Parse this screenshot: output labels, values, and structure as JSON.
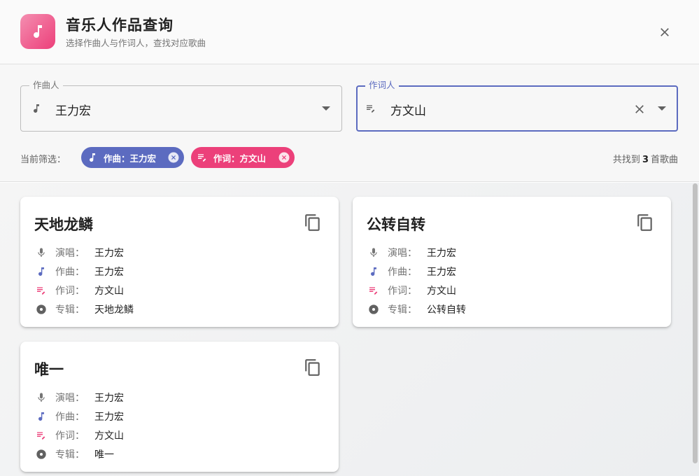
{
  "header": {
    "title": "音乐人作品查询",
    "subtitle": "选择作曲人与作词人，查找对应歌曲"
  },
  "filters": {
    "composer": {
      "label": "作曲人",
      "value": "王力宏"
    },
    "lyricist": {
      "label": "作词人",
      "value": "方文山"
    }
  },
  "active_filters": {
    "label": "当前筛选：",
    "chips": [
      {
        "text": "作曲：王力宏"
      },
      {
        "text": "作词：方文山"
      }
    ],
    "count_prefix": "共找到",
    "count": "3",
    "count_suffix": "首歌曲"
  },
  "songs": [
    {
      "title": "天地龙鳞",
      "singer_label": "演唱：",
      "singer": "王力宏",
      "composer_label": "作曲：",
      "composer": "王力宏",
      "lyricist_label": "作词：",
      "lyricist": "方文山",
      "album_label": "专辑：",
      "album": "天地龙鳞"
    },
    {
      "title": "公转自转",
      "singer_label": "演唱：",
      "singer": "王力宏",
      "composer_label": "作曲：",
      "composer": "王力宏",
      "lyricist_label": "作词：",
      "lyricist": "方文山",
      "album_label": "专辑：",
      "album": "公转自转"
    },
    {
      "title": "唯一",
      "singer_label": "演唱：",
      "singer": "王力宏",
      "composer_label": "作曲：",
      "composer": "王力宏",
      "lyricist_label": "作词：",
      "lyricist": "方文山",
      "album_label": "专辑：",
      "album": "唯一"
    }
  ],
  "colors": {
    "accent_blue": "#5c6bc0",
    "accent_pink": "#ec407a",
    "app_icon_gradient": [
      "#f48fb1",
      "#ec407a"
    ]
  },
  "icons": {
    "app": "music-note-icon",
    "close": "close-icon",
    "composer": "music-note-icon",
    "lyricist": "lyrics-edit-icon",
    "singer": "microphone-icon",
    "album": "album-disc-icon",
    "copy": "copy-icon",
    "clear": "clear-icon",
    "dropdown": "dropdown-arrow-icon"
  }
}
